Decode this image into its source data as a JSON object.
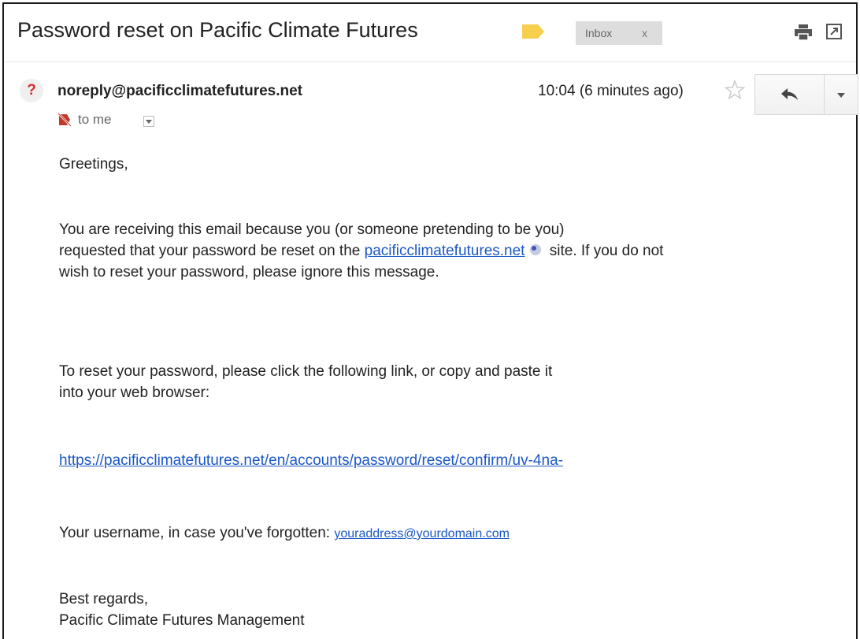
{
  "email": {
    "subject": "Password reset on Pacific Climate Futures",
    "label_chip": "Inbox",
    "label_chip_close": "x",
    "sender": "noreply@pacificclimatefutures.net",
    "sender_avatar": "?",
    "time": "10:04 (6 minutes ago)",
    "recipient": "to me"
  },
  "body": {
    "greeting": "Greetings,",
    "p1_line1": "You are receiving this email because you (or someone pretending to be you)",
    "p1_line2_prefix": "requested that your password be reset on the ",
    "p1_link": "pacificclimatefutures.net",
    "p1_line2_suffix": " site.  If you do not",
    "p1_line3": "wish to reset your password, please ignore this message.",
    "p2_line1": "To reset your password, please click the following link, or copy and paste it",
    "p2_line2": "into your web browser:",
    "reset_link": "https://pacificclimatefutures.net/en/accounts/password/reset/confirm/uv-4na-",
    "username_prefix": "Your username, in case you've forgotten: ",
    "username_link": "youraddress@yourdomain.com",
    "closing1": "Best regards,",
    "closing2": "Pacific Climate Futures Management"
  },
  "icons": {
    "label_tag": "label-icon",
    "print": "print-icon",
    "new_window": "new-window-icon",
    "star": "star-icon",
    "reply": "reply-icon",
    "more": "chevron-down-icon",
    "to": "encryption-warning-icon",
    "globe": "globe-icon"
  },
  "colors": {
    "label_tag": "#f7cf4e",
    "link": "#1a57c6",
    "avatar_q": "#d92e2e",
    "chip_bg": "#dddddd"
  }
}
